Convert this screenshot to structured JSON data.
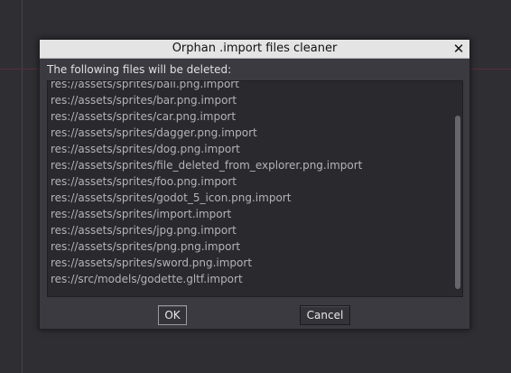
{
  "dialog": {
    "title": "Orphan .import files cleaner",
    "close_icon": "close-icon",
    "header": "The following files will be deleted:",
    "files": [
      "res://assets/sprites/ball.png.import",
      "res://assets/sprites/bar.png.import",
      "res://assets/sprites/car.png.import",
      "res://assets/sprites/dagger.png.import",
      "res://assets/sprites/dog.png.import",
      "res://assets/sprites/file_deleted_from_explorer.png.import",
      "res://assets/sprites/foo.png.import",
      "res://assets/sprites/godot_5_icon.png.import",
      "res://assets/sprites/import.import",
      "res://assets/sprites/jpg.png.import",
      "res://assets/sprites/png.png.import",
      "res://assets/sprites/sword.png.import",
      "res://src/models/godette.gltf.import"
    ],
    "ok_label": "OK",
    "cancel_label": "Cancel"
  },
  "colors": {
    "background": "#2f2e33",
    "dialog_body": "#3b3a41",
    "titlebar": "#e4e4e4",
    "list_text": "#b4b4b4"
  }
}
